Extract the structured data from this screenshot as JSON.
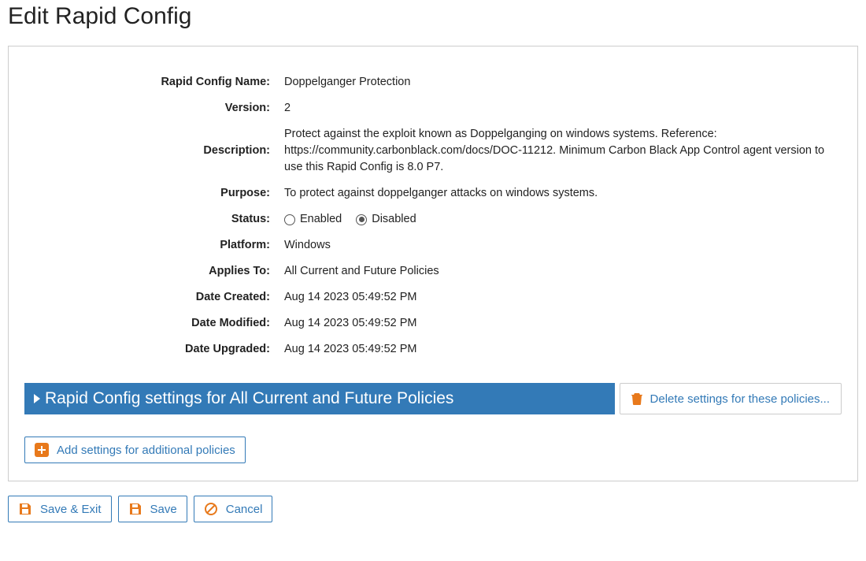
{
  "page_title": "Edit Rapid Config",
  "labels": {
    "name": "Rapid Config Name:",
    "version": "Version:",
    "description": "Description:",
    "purpose": "Purpose:",
    "status": "Status:",
    "platform": "Platform:",
    "applies_to": "Applies To:",
    "date_created": "Date Created:",
    "date_modified": "Date Modified:",
    "date_upgraded": "Date Upgraded:"
  },
  "values": {
    "name": "Doppelganger Protection",
    "version": "2",
    "description": "Protect against the exploit known as Doppelganging on windows systems. Reference: https://community.carbonblack.com/docs/DOC-11212. Minimum Carbon Black App Control agent version to use this Rapid Config is 8.0 P7.",
    "purpose": "To protect against doppelganger attacks on windows systems.",
    "platform": "Windows",
    "applies_to": "All Current and Future Policies",
    "date_created": "Aug 14 2023 05:49:52 PM",
    "date_modified": "Aug 14 2023 05:49:52 PM",
    "date_upgraded": "Aug 14 2023 05:49:52 PM"
  },
  "status": {
    "options": {
      "enabled_label": "Enabled",
      "disabled_label": "Disabled"
    },
    "selected": "disabled"
  },
  "settings_header": "Rapid Config settings for All Current and Future Policies",
  "buttons": {
    "delete_settings": "Delete settings for these policies...",
    "add_settings": "Add settings for additional policies",
    "save_exit": "Save & Exit",
    "save": "Save",
    "cancel": "Cancel"
  },
  "colors": {
    "accent_blue": "#337ab7",
    "accent_orange": "#e8791b"
  }
}
